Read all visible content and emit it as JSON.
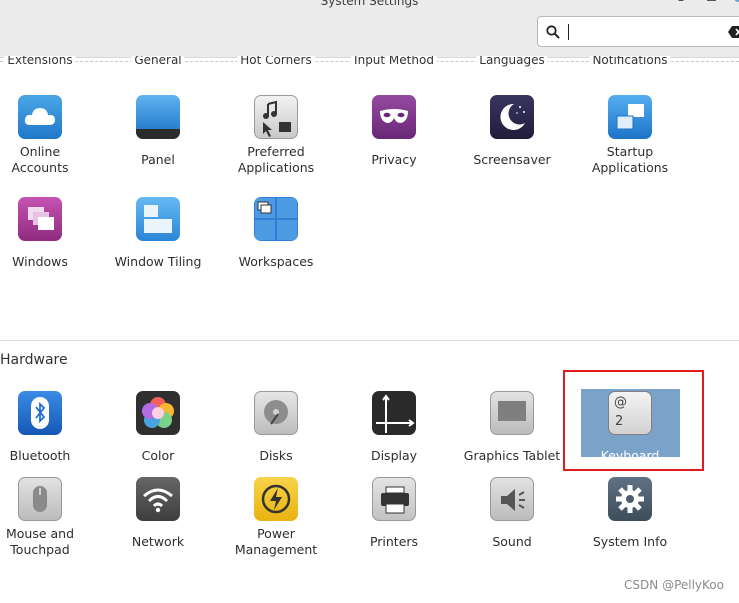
{
  "window": {
    "title": "System Settings",
    "minimize_glyph": "–"
  },
  "search": {
    "value": "",
    "icon": "search-icon",
    "clear_icon": "clear-icon"
  },
  "categories": [
    "Extensions",
    "General",
    "Hot Corners",
    "Input Method",
    "Languages",
    "Notifications"
  ],
  "personal_items": [
    {
      "label": "Online\nAccounts",
      "icon": "cloud-icon",
      "color": "#2d8fd5"
    },
    {
      "label": "Panel",
      "icon": "panel-icon",
      "color": "#1e6ec8"
    },
    {
      "label": "Preferred\nApplications",
      "icon": "music-pointer-icon",
      "color": "#6b6b6b"
    },
    {
      "label": "Privacy",
      "icon": "mask-icon",
      "color": "#7a2d86"
    },
    {
      "label": "Screensaver",
      "icon": "moon-icon",
      "color": "#2f2a4f"
    },
    {
      "label": "Startup\nApplications",
      "icon": "windows-stack-icon",
      "color": "#2b8dd8"
    },
    {
      "label": "Windows",
      "icon": "window-stack-icon",
      "color": "#b03b9c"
    },
    {
      "label": "Window Tiling",
      "icon": "tiling-icon",
      "color": "#3a9ae2"
    },
    {
      "label": "Workspaces",
      "icon": "workspaces-icon",
      "color": "#2f7fd4"
    }
  ],
  "hardware": {
    "title": "Hardware",
    "items": [
      {
        "label": "Bluetooth",
        "icon": "bluetooth-icon",
        "color": "#1f6fd1"
      },
      {
        "label": "Color",
        "icon": "color-icon",
        "color": "#2f2f2f"
      },
      {
        "label": "Disks",
        "icon": "disk-icon",
        "color": "#9a9a9a"
      },
      {
        "label": "Display",
        "icon": "display-icon",
        "color": "#2a2a2a"
      },
      {
        "label": "Graphics Tablet",
        "icon": "tablet-icon",
        "color": "#8f8f8f"
      },
      {
        "label": "Keyboard",
        "icon": "keyboard-key-icon",
        "color": "#d7d7d7",
        "selected": true,
        "key_top": "@",
        "key_bottom": "2"
      },
      {
        "label": "Mouse and\nTouchpad",
        "icon": "mouse-icon",
        "color": "#8c8c8c"
      },
      {
        "label": "Network",
        "icon": "wifi-icon",
        "color": "#555555"
      },
      {
        "label": "Power\nManagement",
        "icon": "power-icon",
        "color": "#f2c41a"
      },
      {
        "label": "Printers",
        "icon": "printer-icon",
        "color": "#666666"
      },
      {
        "label": "Sound",
        "icon": "speaker-icon",
        "color": "#8c8c8c"
      },
      {
        "label": "System Info",
        "icon": "gear-icon",
        "color": "#4d5d6c"
      }
    ]
  },
  "colors": {
    "selection": "#7ba3ca",
    "highlight_box": "#e31c1c"
  },
  "watermark": "CSDN @PellyKoo"
}
